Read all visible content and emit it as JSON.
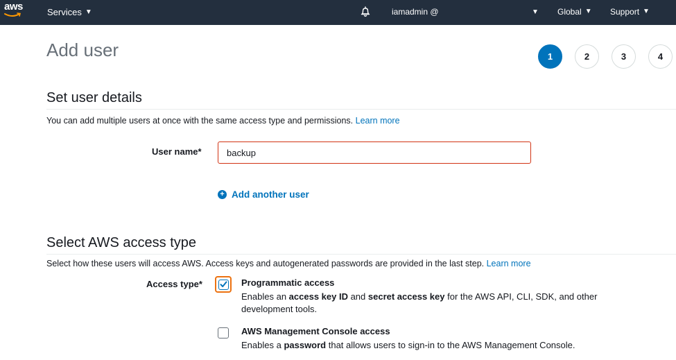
{
  "topnav": {
    "logo_text": "aws",
    "services_label": "Services",
    "user_label": "iamadmin @",
    "region_label": "Global",
    "support_label": "Support",
    "bg_color": "#232f3e"
  },
  "page": {
    "title": "Add user"
  },
  "wizard_steps": [
    "1",
    "2",
    "3",
    "4"
  ],
  "active_step": "1",
  "user_details": {
    "section_title": "Set user details",
    "description": "You can add multiple users at once with the same access type and permissions.",
    "learn_more": "Learn more",
    "username_label": "User name*",
    "username_value": "backup",
    "add_another_user": "Add another user"
  },
  "access_type": {
    "section_title": "Select AWS access type",
    "description": "Select how these users will access AWS. Access keys and autogenerated passwords are provided in the last step.",
    "learn_more": "Learn more",
    "label": "Access type*",
    "programmatic": {
      "title": "Programmatic access",
      "desc_1": "Enables an ",
      "desc_bold_1": "access key ID",
      "desc_2": " and ",
      "desc_bold_2": "secret access key",
      "desc_3": " for the AWS API, CLI, SDK, and other development tools.",
      "checked": true
    },
    "console": {
      "title": "AWS Management Console access",
      "desc_1": "Enables a ",
      "desc_bold_1": "password",
      "desc_2": " that allows users to sign-in to the AWS Management Console.",
      "checked": false
    }
  },
  "colors": {
    "accent": "#0073bb",
    "error_border": "#d13212",
    "focus_ring": "#ec7211"
  }
}
